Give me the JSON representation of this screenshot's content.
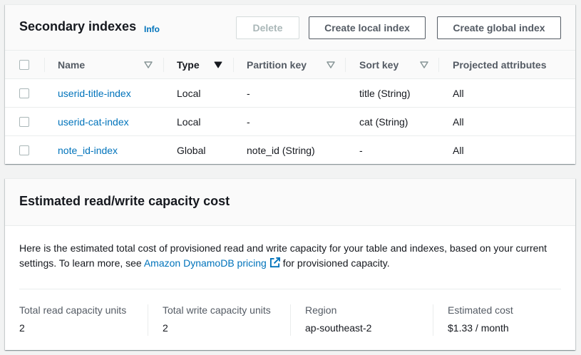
{
  "indexes_panel": {
    "title": "Secondary indexes",
    "info_label": "Info",
    "buttons": {
      "delete": "Delete",
      "create_local": "Create local index",
      "create_global": "Create global index"
    },
    "columns": [
      "Name",
      "Type",
      "Partition key",
      "Sort key",
      "Projected attributes"
    ],
    "sorted_column": "Type",
    "rows": [
      {
        "name": "userid-title-index",
        "type": "Local",
        "partition_key": "-",
        "sort_key": "title (String)",
        "projected": "All"
      },
      {
        "name": "userid-cat-index",
        "type": "Local",
        "partition_key": "-",
        "sort_key": "cat (String)",
        "projected": "All"
      },
      {
        "name": "note_id-index",
        "type": "Global",
        "partition_key": "note_id (String)",
        "sort_key": "-",
        "projected": "All"
      }
    ]
  },
  "cost_panel": {
    "title": "Estimated read/write capacity cost",
    "description_before": "Here is the estimated total cost of provisioned read and write capacity for your table and indexes, based on your current settings. To learn more, see ",
    "link_text": "Amazon DynamoDB pricing",
    "description_after": " for provisioned capacity.",
    "metrics": [
      {
        "label": "Total read capacity units",
        "value": "2"
      },
      {
        "label": "Total write capacity units",
        "value": "2"
      },
      {
        "label": "Region",
        "value": "ap-southeast-2"
      },
      {
        "label": "Estimated cost",
        "value": "$1.33 / month"
      }
    ]
  },
  "colors": {
    "link": "#0073bb",
    "header_bg": "#fafafa",
    "page_bg": "#f2f3f3",
    "border": "#eaeded",
    "button_text": "#545b64"
  }
}
